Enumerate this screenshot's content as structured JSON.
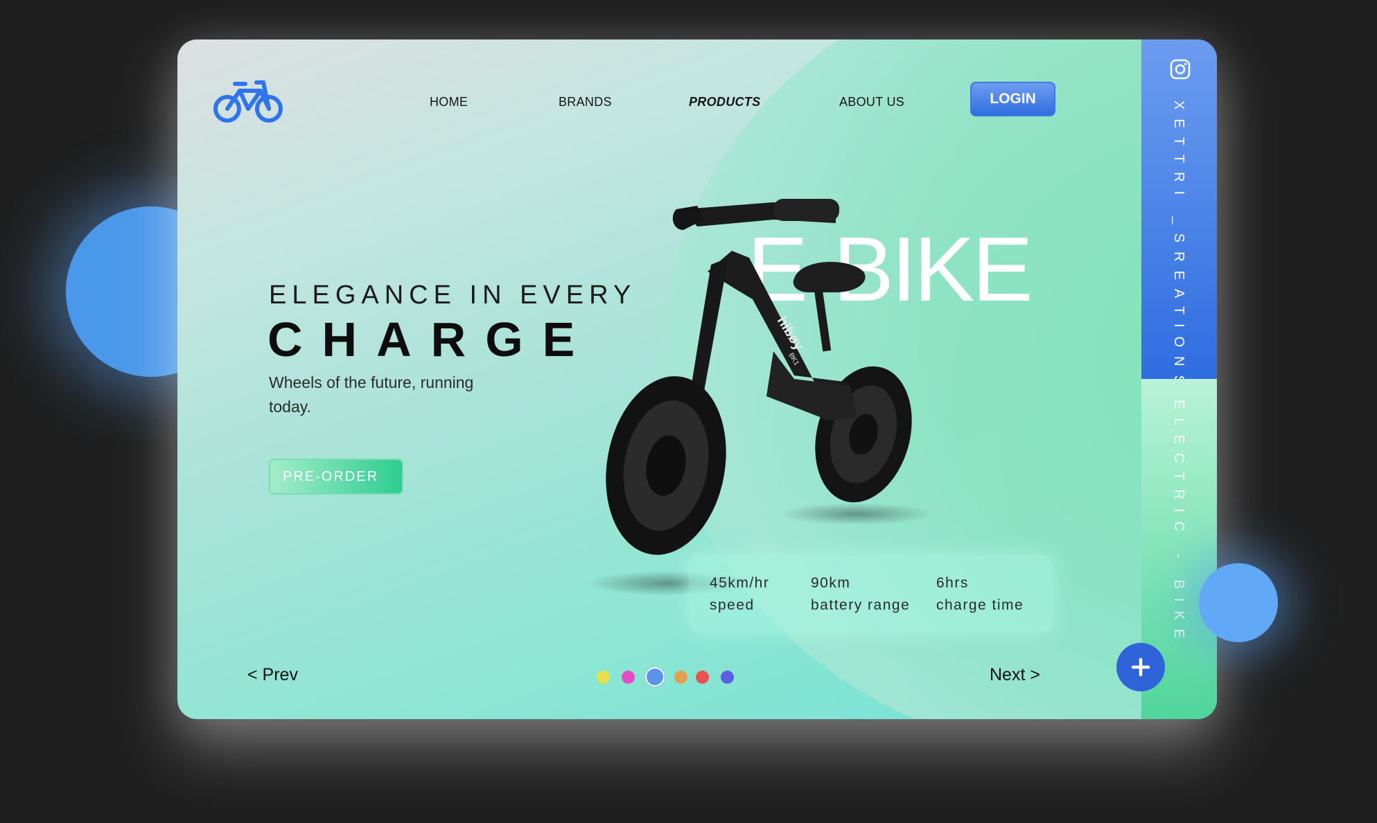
{
  "nav": {
    "items": [
      {
        "label": "HOME"
      },
      {
        "label": "BRANDS"
      },
      {
        "label": "PRODUCTS",
        "active": true
      },
      {
        "label": "ABOUT US"
      }
    ],
    "login_label": "LOGIN"
  },
  "hero": {
    "eyebrow": "ELEGANCE IN EVERY",
    "headline": "CHARGE",
    "tagline": "Wheels of the future, running today.",
    "preorder_label": "PRE-ORDER",
    "big_title": "E-BIKE"
  },
  "bike": {
    "brand_text": "hibøy",
    "model_text": "BK1"
  },
  "specs": [
    {
      "value": "45km/hr",
      "label": "speed"
    },
    {
      "value": "90km",
      "label": "battery range"
    },
    {
      "value": "6hrs",
      "label": "charge time"
    }
  ],
  "pager": {
    "prev_label": "< Prev",
    "next_label": "Next >",
    "dots": [
      {
        "color": "#e6e04a"
      },
      {
        "color": "#e64bc7"
      },
      {
        "color": "#5b93ea",
        "active": true
      },
      {
        "color": "#e3a04e"
      },
      {
        "color": "#e9524f"
      },
      {
        "color": "#5a5fe3"
      }
    ]
  },
  "side": {
    "top_text": "XETTRI _SREATIONS",
    "bottom_text": "ELECTRIC - BIKE",
    "icon": "instagram-icon"
  },
  "colors": {
    "accent_blue": "#2f6de0",
    "accent_green": "#2ccd8f"
  }
}
